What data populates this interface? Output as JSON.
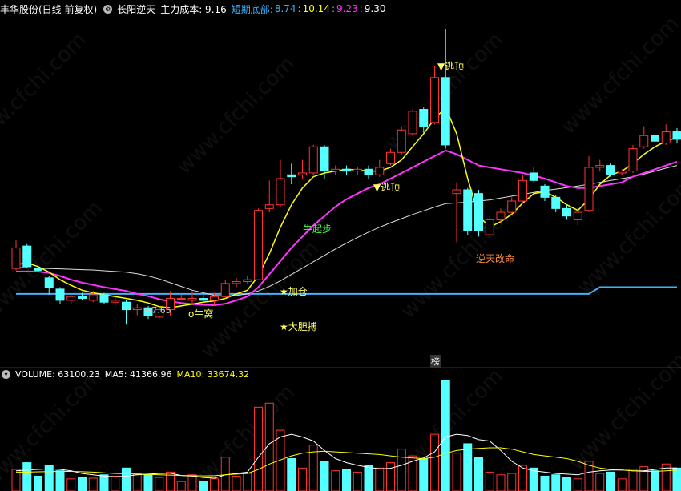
{
  "header": {
    "stock": "丰华股份(日线 前复权)",
    "indicator": "长阳逆天",
    "cost_label": "主力成本: 9.16",
    "bottom_label": "短期底部:",
    "bottom_v1": "8.74",
    "bottom_v2": "10.14",
    "bottom_v3": "9.23",
    "bottom_v4": "9.30"
  },
  "volume_header": {
    "vol_label": "VOLUME: 63100.23",
    "ma5_label": "MA5: 41366.96",
    "ma10_label": "MA10: 33674.32"
  },
  "annotations": {
    "top_escape": "▼逃顶",
    "mid_escape": "▼逃顶",
    "bull_start": "牛起步",
    "add_position": "★加仓",
    "bull_nest": "o牛窝",
    "bold_bet": "★大胆搏",
    "reversal": "逆天改命",
    "low_price": "7.65",
    "list_tag": "榜"
  },
  "watermark": "www.cfchi.com",
  "colors": {
    "up": "#ff3232",
    "down": "#54ffff",
    "ma_short": "#ffff00",
    "ma_mid": "#ff33ff",
    "ma_long": "#dddddd",
    "bottom_line": "#3cb4ff",
    "separator": "#b40000"
  },
  "chart_data": {
    "type": "candlestick",
    "price_range": [
      7.3,
      16.5
    ],
    "volume_range": [
      0,
      80000
    ],
    "candles": [
      {
        "o": 9.8,
        "c": 10.35,
        "h": 10.55,
        "l": 9.75,
        "v": 16000
      },
      {
        "o": 10.4,
        "c": 9.85,
        "h": 10.45,
        "l": 9.8,
        "v": 21000
      },
      {
        "o": 9.8,
        "c": 9.75,
        "h": 9.9,
        "l": 9.65,
        "v": 11000
      },
      {
        "o": 9.55,
        "c": 9.3,
        "h": 9.6,
        "l": 9.1,
        "v": 19000
      },
      {
        "o": 9.25,
        "c": 8.95,
        "h": 9.3,
        "l": 8.85,
        "v": 15000
      },
      {
        "o": 8.95,
        "c": 9.05,
        "h": 9.1,
        "l": 8.85,
        "v": 9000
      },
      {
        "o": 9.05,
        "c": 9.0,
        "h": 9.15,
        "l": 8.95,
        "v": 10000
      },
      {
        "o": 8.95,
        "c": 9.1,
        "h": 9.2,
        "l": 8.9,
        "v": 9500
      },
      {
        "o": 9.1,
        "c": 8.9,
        "h": 9.15,
        "l": 8.85,
        "v": 12000
      },
      {
        "o": 8.9,
        "c": 8.95,
        "h": 9.05,
        "l": 8.8,
        "v": 11000
      },
      {
        "o": 8.9,
        "c": 8.7,
        "h": 8.95,
        "l": 8.3,
        "v": 17000
      },
      {
        "o": 8.7,
        "c": 8.75,
        "h": 8.85,
        "l": 8.55,
        "v": 13000
      },
      {
        "o": 8.75,
        "c": 8.55,
        "h": 8.8,
        "l": 8.45,
        "v": 12000
      },
      {
        "o": 8.5,
        "c": 8.7,
        "h": 8.8,
        "l": 8.45,
        "v": 10000
      },
      {
        "o": 8.7,
        "c": 9.0,
        "h": 9.2,
        "l": 8.55,
        "v": 14000
      },
      {
        "o": 9.0,
        "c": 9.0,
        "h": 9.1,
        "l": 8.95,
        "v": 7000
      },
      {
        "o": 8.95,
        "c": 9.0,
        "h": 9.2,
        "l": 8.85,
        "v": 12000
      },
      {
        "o": 9.0,
        "c": 8.95,
        "h": 9.1,
        "l": 8.9,
        "v": 7000
      },
      {
        "o": 8.95,
        "c": 9.05,
        "h": 9.15,
        "l": 8.8,
        "v": 9000
      },
      {
        "o": 9.05,
        "c": 9.4,
        "h": 9.5,
        "l": 9.0,
        "v": 25000
      },
      {
        "o": 9.4,
        "c": 9.45,
        "h": 9.55,
        "l": 9.3,
        "v": 11000
      },
      {
        "o": 9.45,
        "c": 9.5,
        "h": 9.6,
        "l": 9.4,
        "v": 13000
      },
      {
        "o": 9.5,
        "c": 11.35,
        "h": 11.4,
        "l": 9.55,
        "v": 62000
      },
      {
        "o": 11.4,
        "c": 11.5,
        "h": 12.15,
        "l": 11.3,
        "v": 65000
      },
      {
        "o": 11.5,
        "c": 12.2,
        "h": 12.7,
        "l": 11.45,
        "v": 45000
      },
      {
        "o": 12.3,
        "c": 12.25,
        "h": 12.6,
        "l": 12.05,
        "v": 24000
      },
      {
        "o": 12.3,
        "c": 12.35,
        "h": 12.7,
        "l": 12.2,
        "v": 17000
      },
      {
        "o": 12.35,
        "c": 13.05,
        "h": 13.1,
        "l": 12.3,
        "v": 34000
      },
      {
        "o": 13.05,
        "c": 12.4,
        "h": 13.1,
        "l": 12.2,
        "v": 22000
      },
      {
        "o": 12.4,
        "c": 12.45,
        "h": 12.55,
        "l": 12.3,
        "v": 15000
      },
      {
        "o": 12.45,
        "c": 12.4,
        "h": 12.55,
        "l": 12.3,
        "v": 16000
      },
      {
        "o": 12.4,
        "c": 12.45,
        "h": 12.5,
        "l": 12.3,
        "v": 14000
      },
      {
        "o": 12.45,
        "c": 12.3,
        "h": 12.55,
        "l": 12.2,
        "v": 19000
      },
      {
        "o": 12.3,
        "c": 12.5,
        "h": 12.7,
        "l": 12.25,
        "v": 17000
      },
      {
        "o": 12.6,
        "c": 12.9,
        "h": 13.0,
        "l": 12.55,
        "v": 21000
      },
      {
        "o": 12.9,
        "c": 13.5,
        "h": 13.6,
        "l": 12.85,
        "v": 31000
      },
      {
        "o": 13.4,
        "c": 14.0,
        "h": 14.05,
        "l": 13.35,
        "v": 26000
      },
      {
        "o": 14.05,
        "c": 13.6,
        "h": 14.1,
        "l": 13.4,
        "v": 24000
      },
      {
        "o": 13.7,
        "c": 14.9,
        "h": 15.2,
        "l": 13.65,
        "v": 42000
      },
      {
        "o": 14.9,
        "c": 13.1,
        "h": 16.2,
        "l": 13.0,
        "v": 82000
      },
      {
        "o": 11.8,
        "c": 11.9,
        "h": 12.1,
        "l": 10.5,
        "v": 28000
      },
      {
        "o": 11.9,
        "c": 10.8,
        "h": 11.95,
        "l": 10.7,
        "v": 35000
      },
      {
        "o": 11.8,
        "c": 10.8,
        "h": 11.9,
        "l": 10.65,
        "v": 25000
      },
      {
        "o": 10.7,
        "c": 11.1,
        "h": 11.2,
        "l": 10.65,
        "v": 14000
      },
      {
        "o": 11.1,
        "c": 11.3,
        "h": 11.4,
        "l": 11.0,
        "v": 12000
      },
      {
        "o": 11.3,
        "c": 11.6,
        "h": 11.7,
        "l": 11.25,
        "v": 13000
      },
      {
        "o": 11.6,
        "c": 12.15,
        "h": 12.3,
        "l": 11.55,
        "v": 19000
      },
      {
        "o": 12.35,
        "c": 12.15,
        "h": 12.5,
        "l": 12.1,
        "v": 17000
      },
      {
        "o": 12.0,
        "c": 11.7,
        "h": 12.05,
        "l": 11.6,
        "v": 11000
      },
      {
        "o": 11.7,
        "c": 11.4,
        "h": 11.75,
        "l": 11.3,
        "v": 12000
      },
      {
        "o": 11.4,
        "c": 11.2,
        "h": 11.5,
        "l": 11.1,
        "v": 10000
      },
      {
        "o": 11.1,
        "c": 11.3,
        "h": 11.45,
        "l": 10.95,
        "v": 9000
      },
      {
        "o": 11.35,
        "c": 12.5,
        "h": 12.8,
        "l": 11.3,
        "v": 22000
      },
      {
        "o": 12.5,
        "c": 12.55,
        "h": 12.7,
        "l": 12.4,
        "v": 13000
      },
      {
        "o": 12.55,
        "c": 12.3,
        "h": 12.6,
        "l": 12.25,
        "v": 14000
      },
      {
        "o": 12.35,
        "c": 12.4,
        "h": 12.45,
        "l": 12.3,
        "v": 9000
      },
      {
        "o": 12.4,
        "c": 13.0,
        "h": 13.1,
        "l": 12.35,
        "v": 16000
      },
      {
        "o": 13.05,
        "c": 13.35,
        "h": 13.6,
        "l": 13.0,
        "v": 18000
      },
      {
        "o": 13.35,
        "c": 13.2,
        "h": 13.45,
        "l": 13.1,
        "v": 15000
      },
      {
        "o": 13.15,
        "c": 13.45,
        "h": 13.65,
        "l": 13.1,
        "v": 20000
      },
      {
        "o": 13.45,
        "c": 13.25,
        "h": 13.55,
        "l": 13.15,
        "v": 17000
      }
    ],
    "ma_short": [
      9.9,
      9.95,
      9.85,
      9.7,
      9.5,
      9.35,
      9.22,
      9.15,
      9.1,
      9.05,
      9.0,
      8.95,
      8.88,
      8.78,
      8.75,
      8.8,
      8.85,
      8.9,
      8.93,
      9.0,
      9.12,
      9.22,
      9.6,
      10.2,
      10.9,
      11.5,
      11.95,
      12.25,
      12.35,
      12.4,
      12.45,
      12.43,
      12.4,
      12.4,
      12.5,
      12.7,
      13.05,
      13.4,
      13.8,
      14.1,
      13.4,
      12.2,
      11.2,
      10.9,
      11.05,
      11.25,
      11.55,
      11.8,
      11.85,
      11.7,
      11.5,
      11.35,
      11.65,
      12.05,
      12.3,
      12.4,
      12.6,
      12.85,
      13.05,
      13.2,
      13.3
    ],
    "ma_mid": [
      9.72,
      9.72,
      9.72,
      9.68,
      9.6,
      9.5,
      9.42,
      9.36,
      9.3,
      9.25,
      9.2,
      9.12,
      9.06,
      8.98,
      8.92,
      8.88,
      8.85,
      8.83,
      8.82,
      8.86,
      8.95,
      9.05,
      9.3,
      9.65,
      10.0,
      10.35,
      10.65,
      10.95,
      11.2,
      11.45,
      11.65,
      11.8,
      11.95,
      12.05,
      12.2,
      12.35,
      12.5,
      12.65,
      12.8,
      12.95,
      12.85,
      12.7,
      12.55,
      12.5,
      12.45,
      12.4,
      12.35,
      12.28,
      12.2,
      12.1,
      12.0,
      11.95,
      11.95,
      12.0,
      12.05,
      12.1,
      12.25,
      12.35,
      12.45,
      12.55,
      12.65
    ],
    "ma_long": [
      9.83,
      9.82,
      9.81,
      9.8,
      9.79,
      9.78,
      9.77,
      9.76,
      9.74,
      9.72,
      9.7,
      9.66,
      9.6,
      9.52,
      9.42,
      9.32,
      9.22,
      9.15,
      9.08,
      9.07,
      9.08,
      9.12,
      9.2,
      9.32,
      9.47,
      9.64,
      9.81,
      9.98,
      10.15,
      10.32,
      10.48,
      10.63,
      10.77,
      10.9,
      11.02,
      11.13,
      11.24,
      11.34,
      11.44,
      11.53,
      11.55,
      11.57,
      11.6,
      11.63,
      11.68,
      11.73,
      11.78,
      11.83,
      11.88,
      11.92,
      11.96,
      12.0,
      12.05,
      12.1,
      12.15,
      12.2,
      12.25,
      12.32,
      12.4,
      12.48,
      12.55
    ],
    "bottom_line": [
      9.12,
      9.12,
      9.12,
      9.12,
      9.12,
      9.12,
      9.12,
      9.12,
      9.12,
      9.12,
      9.12,
      9.12,
      9.12,
      9.12,
      9.12,
      9.12,
      9.12,
      9.12,
      9.12,
      9.12,
      9.12,
      9.12,
      9.12,
      9.12,
      9.12,
      9.12,
      9.12,
      9.12,
      9.12,
      9.12,
      9.12,
      9.12,
      9.12,
      9.12,
      9.12,
      9.12,
      9.12,
      9.12,
      9.12,
      9.12,
      9.12,
      9.12,
      9.12,
      9.12,
      9.12,
      9.12,
      9.12,
      9.12,
      9.12,
      9.12,
      9.12,
      9.12,
      9.12,
      9.3,
      9.3,
      9.3,
      9.3,
      9.3,
      9.3,
      9.3,
      9.3
    ],
    "vol_ma5": [
      15000,
      15500,
      16000,
      16500,
      16000,
      15000,
      13000,
      12000,
      11000,
      10500,
      11000,
      12000,
      12500,
      13000,
      13200,
      11500,
      11000,
      10000,
      9500,
      12000,
      13000,
      14000,
      25000,
      35000,
      40000,
      42000,
      40000,
      37000,
      30000,
      24000,
      21000,
      19000,
      17500,
      16500,
      16800,
      19000,
      22000,
      24500,
      29000,
      40000,
      42000,
      41000,
      38000,
      37000,
      30000,
      22000,
      17000,
      15000,
      14000,
      13000,
      12500,
      12000,
      14000,
      15000,
      15500,
      15500,
      15000,
      15000,
      16000,
      17000,
      17000
    ],
    "vol_ma10": [
      14000,
      14000,
      14200,
      14400,
      14500,
      14500,
      14300,
      14000,
      13500,
      13000,
      12800,
      12500,
      12300,
      12000,
      11800,
      11500,
      11300,
      11200,
      11300,
      12000,
      12500,
      13000,
      16000,
      20000,
      23000,
      26000,
      28000,
      29000,
      29500,
      29000,
      28500,
      28000,
      27500,
      27000,
      26000,
      25000,
      24500,
      24000,
      25000,
      28000,
      30000,
      31000,
      31500,
      32000,
      32000,
      31000,
      29000,
      27000,
      26000,
      25000,
      24000,
      22000,
      19000,
      17000,
      16000,
      15500,
      15000,
      14500,
      14500,
      15000,
      15500
    ]
  }
}
